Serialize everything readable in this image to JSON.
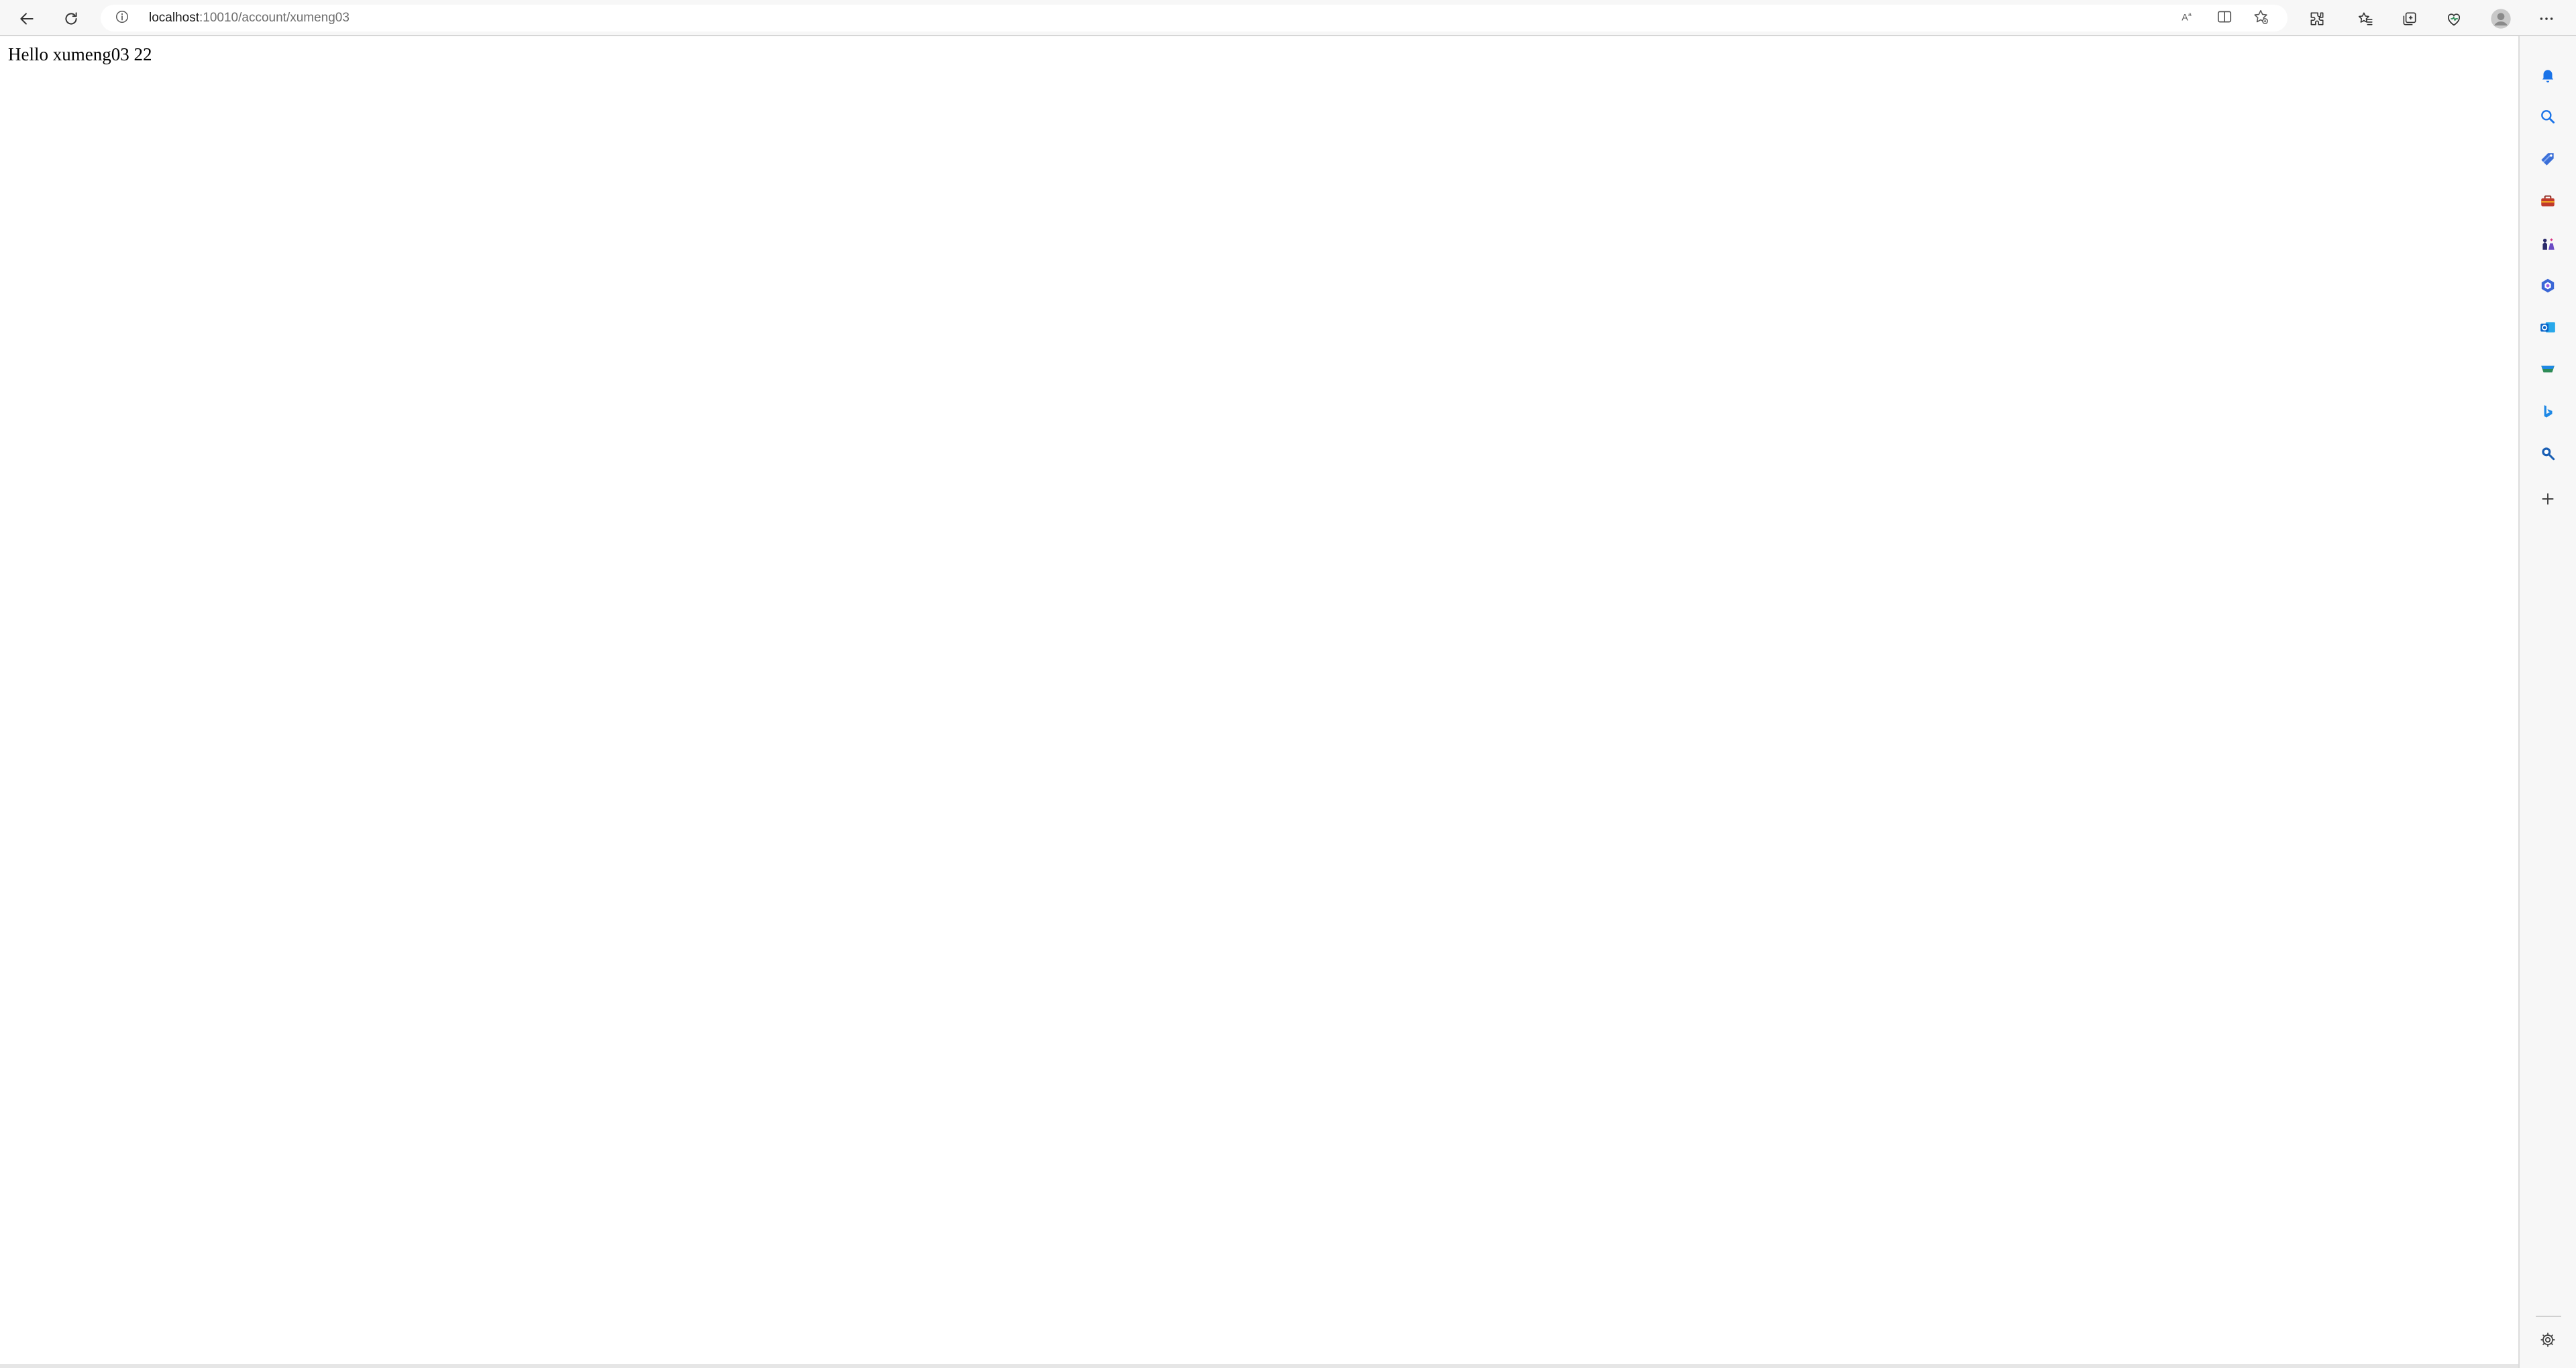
{
  "address_bar": {
    "host": "localhost",
    "path": ":10010/account/xumeng03"
  },
  "page": {
    "greeting": "Hello xumeng03 22"
  },
  "toolbar": {
    "back_icon": "back-arrow-icon",
    "refresh_icon": "refresh-icon",
    "info_icon": "info-icon",
    "read_aloud_icon": "read-aloud-icon",
    "split_screen_icon": "split-screen-icon",
    "add_favorite_icon": "add-favorite-icon",
    "extensions_icon": "extensions-icon",
    "favorites_icon": "favorites-icon",
    "collections_icon": "collections-icon",
    "browser_essentials_icon": "browser-essentials-icon",
    "profile_icon": "profile-avatar-icon",
    "more_icon": "more-options-icon"
  },
  "sidebar": {
    "items": [
      {
        "icon": "notifications-icon",
        "color": "#1a73e8"
      },
      {
        "icon": "search-icon",
        "color": "#1a73e8"
      },
      {
        "icon": "shopping-tag-icon",
        "color": "#3b6fd8"
      },
      {
        "icon": "tools-icon",
        "color": "#c0392b"
      },
      {
        "icon": "games-icon",
        "color": "#6a4bc4"
      },
      {
        "icon": "microsoft-365-icon",
        "color": "#3a66d6"
      },
      {
        "icon": "outlook-icon",
        "color": "#0a64c8"
      },
      {
        "icon": "drop-icon",
        "color": "#2e8b57"
      },
      {
        "icon": "bing-icon",
        "color": "#1e88e5"
      },
      {
        "icon": "search-alt-icon",
        "color": "#1a5fb4"
      },
      {
        "icon": "add-icon",
        "color": "#444444"
      }
    ],
    "settings_icon": "settings-gear-icon"
  }
}
